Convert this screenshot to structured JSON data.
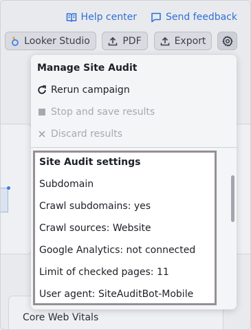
{
  "top_links": {
    "help_center": "Help center",
    "send_feedback": "Send feedback"
  },
  "toolbar": {
    "looker_label": "Looker Studio",
    "pdf_label": "PDF",
    "export_label": "Export"
  },
  "background": {
    "card_title": "Core Web Vitals"
  },
  "menu": {
    "heading": "Manage Site Audit",
    "rerun": "Rerun campaign",
    "stop": "Stop and save results",
    "discard": "Discard results",
    "settings_title": "Site Audit settings",
    "settings_rows": [
      "Subdomain",
      "Crawl subdomains: yes",
      "Crawl sources: Website",
      "Google Analytics: not connected",
      "Limit of checked pages: 11",
      "User agent: SiteAuditBot-Mobile"
    ]
  },
  "colors": {
    "link": "#2f6fd6",
    "disabled_text": "#a6a9b0",
    "highlight_border": "#958f95"
  },
  "icons": {
    "help": "book-icon",
    "feedback": "speech-bubble-icon",
    "looker": "looker-logo-icon",
    "upload": "upload-icon",
    "settings": "gear-icon",
    "rerun": "refresh-icon",
    "stop": "stop-square-icon",
    "discard": "close-icon"
  }
}
